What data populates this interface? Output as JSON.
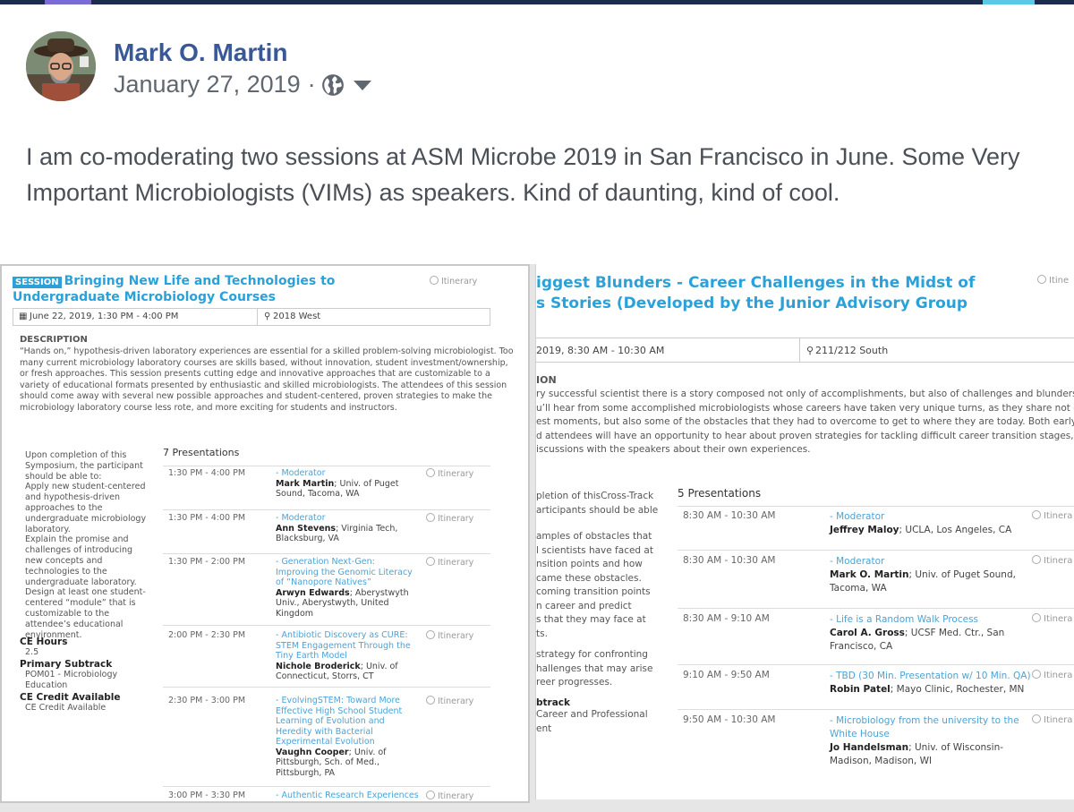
{
  "post": {
    "author": "Mark O. Martin",
    "date": "January 27, 2019",
    "separator": "·",
    "text": "I am co-moderating two sessions at ASM Microbe 2019 in San Francisco in June. Some Very Important Microbiologists (VIMs) as speakers. Kind of daunting, kind of cool."
  },
  "colors": {
    "link": "#385898",
    "session_accent": "#2aa1d8",
    "topbar": "#1d2b4f"
  },
  "left_session": {
    "tag": "SESSION",
    "title_1": "Bringing New Life and Technologies to",
    "title_2": "Undergraduate Microbiology Courses",
    "itinerary": "Itinerary",
    "date_time": "June 22, 2019, 1:30 PM - 4:00 PM",
    "location": "2018 West",
    "description_header": "DESCRIPTION",
    "description_lines": [
      "“Hands on,” hypothesis-driven laboratory experiences are essential for a skilled problem-solving microbiologist. Too",
      "many current microbiology laboratory courses are skills based, without innovation, student investment/ownership,",
      "or fresh approaches. This session presents cutting edge and innovative approaches that are customizable to a",
      "variety of educational formats presented by enthusiastic and skilled microbiologists. The attendees of this session",
      "should come away with several new possible approaches and student-centered, proven strategies to make the",
      "microbiology laboratory course less rote, and more exciting for students and instructors."
    ],
    "objectives_lines": [
      "Upon completion of this",
      "Symposium, the participant",
      "should be able to:",
      "Apply new student-centered",
      "and hypothesis-driven",
      "approaches to the",
      "undergraduate microbiology",
      "laboratory.",
      "Explain the promise and",
      "challenges of introducing",
      "new concepts and",
      "technologies to the",
      "undergraduate laboratory.",
      "Design at least one student-",
      "centered “module” that is",
      "customizable to the",
      "attendee’s educational",
      "environment."
    ],
    "ce_hours_label": "CE Hours",
    "ce_hours_value": "2.5",
    "subtrack_label": "Primary Subtrack",
    "subtrack_value_1": "POM01 - Microbiology",
    "subtrack_value_2": "Education",
    "ce_credit_label": "CE Credit Available",
    "ce_credit_value": "CE Credit Available",
    "presentations_header": "7 Presentations",
    "presentations": [
      {
        "time": "1:30 PM - 4:00 PM",
        "title": "- Moderator",
        "speaker": "Mark Martin",
        "affiliation": "; Univ. of Puget Sound, Tacoma, WA",
        "itinerary": "Itinerary"
      },
      {
        "time": "1:30 PM - 4:00 PM",
        "title": "- Moderator",
        "speaker": "Ann Stevens",
        "affiliation": "; Virginia Tech, Blacksburg, VA",
        "itinerary": "Itinerary"
      },
      {
        "time": "1:30 PM - 2:00 PM",
        "title": "- Generation Next-Gen: Improving the Genomic Literacy of “Nanopore Natives”",
        "speaker": "Arwyn Edwards",
        "affiliation": "; Aberystwyth Univ., Aberystwyth, United Kingdom",
        "itinerary": "Itinerary"
      },
      {
        "time": "2:00 PM - 2:30 PM",
        "title": "- Antibiotic Discovery as CURE: STEM Engagement Through the Tiny Earth Model",
        "speaker": "Nichole Broderick",
        "affiliation": "; Univ. of Connecticut, Storrs, CT",
        "itinerary": "Itinerary"
      },
      {
        "time": "2:30 PM - 3:00 PM",
        "title": "- EvolvingSTEM: Toward More Effective High School Student Learning of Evolution and Heredity with Bacterial Experimental Evolution",
        "speaker": "Vaughn Cooper",
        "affiliation": "; Univ. of Pittsburgh, Sch. of Med., Pittsburgh, PA",
        "itinerary": "Itinerary"
      },
      {
        "time": "3:00 PM - 3:30 PM",
        "title": "- Authentic Research Experiences",
        "speaker": "",
        "affiliation": "",
        "itinerary": "Itinerary"
      }
    ]
  },
  "right_session": {
    "title_1": "iggest Blunders - Career Challenges in the Midst of",
    "title_2": "s Stories (Developed by the Junior Advisory Group",
    "itinerary_top": "Itine",
    "date_time": "2019, 8:30 AM - 10:30 AM",
    "location": "211/212 South",
    "description_header": "ION",
    "description_lines": [
      "ry successful scientist there is a story composed not only of accomplishments, but also of challenges and blunders along the",
      "u’ll hear from some accomplished microbiologists whose careers have taken very unique turns, as they share not only their ac",
      "est moments, but also some of the obstacles that they had to overcome to get to where they are today. Both early career and",
      "d attendees will have an opportunity to hear about proven strategies for tackling difficult career transition stages, and to engag",
      "iscussions with the speakers about their own experiences."
    ],
    "objectives_lines": [
      "pletion of thisCross-Track",
      "articipants should be able",
      "",
      "amples of obstacles that",
      "l scientists have faced at",
      "nsition points and how",
      "came these obstacles.",
      "coming transition points",
      "n career and predict",
      "s that they may face at",
      "ts.",
      "",
      "strategy for confronting",
      "hallenges that may arise",
      "reer progresses."
    ],
    "subtrack_label": "btrack",
    "subtrack_value_1": "Career and Professional",
    "subtrack_value_2": "ent",
    "presentations_header": "5 Presentations",
    "presentations": [
      {
        "time": "8:30 AM - 10:30 AM",
        "title": "- Moderator",
        "speaker": "Jeffrey Maloy",
        "affiliation": "; UCLA, Los Angeles, CA",
        "itinerary": "Itinera"
      },
      {
        "time": "8:30 AM - 10:30 AM",
        "title": "- Moderator",
        "speaker": "Mark O. Martin",
        "affiliation": "; Univ. of Puget Sound, Tacoma, WA",
        "itinerary": "Itinera"
      },
      {
        "time": "8:30 AM - 9:10 AM",
        "title": "- Life is a Random Walk Process",
        "speaker": "Carol A. Gross",
        "affiliation": "; UCSF Med. Ctr., San Francisco, CA",
        "itinerary": "Itinera"
      },
      {
        "time": "9:10 AM - 9:50 AM",
        "title": "- TBD (30 Min. Presentation w/ 10 Min. QA)",
        "speaker": "Robin Patel",
        "affiliation": "; Mayo Clinic, Rochester, MN",
        "itinerary": "Itinera"
      },
      {
        "time": "9:50 AM - 10:30 AM",
        "title": "- Microbiology from the university to the White House",
        "speaker": "Jo Handelsman",
        "affiliation": "; Univ. of Wisconsin-Madison, Madison, WI",
        "itinerary": "Itinera"
      }
    ]
  }
}
